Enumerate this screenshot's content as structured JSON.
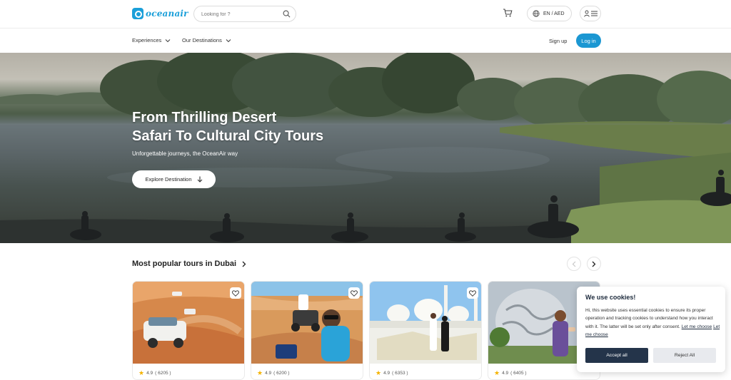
{
  "header": {
    "logo_text": "oceanair",
    "search_placeholder": "Looking for ?",
    "lang_currency": "EN / AED"
  },
  "nav": {
    "experiences": "Experiences",
    "destinations": "Our Destinations",
    "signup": "Sign up",
    "login": "Log in"
  },
  "hero": {
    "title_line1": "From Thrilling Desert",
    "title_line2": "Safari To Cultural City Tours",
    "subtitle": "Unforgettable journeys, the OceanAir way",
    "cta": "Explore Destination"
  },
  "popular": {
    "title": "Most popular tours in Dubai",
    "cards": [
      {
        "rating": "4.9",
        "reviews": "( 6205 )"
      },
      {
        "rating": "4.9",
        "reviews": "( 6200 )"
      },
      {
        "rating": "4.9",
        "reviews": "( 6353 )"
      },
      {
        "rating": "4.9",
        "reviews": "( 6405 )"
      }
    ]
  },
  "cookie": {
    "title": "We use cookies!",
    "body": "Hi, this website uses essential cookies to ensure its proper operation and tracking cookies to understand how you interact with it. The latter will be set only after consent.",
    "link": "Let me choose",
    "accept": "Accept all",
    "reject": "Reject All"
  },
  "colors": {
    "brand_blue": "#1b97d2",
    "cookie_dark": "#24344a",
    "star": "#f5b301"
  }
}
